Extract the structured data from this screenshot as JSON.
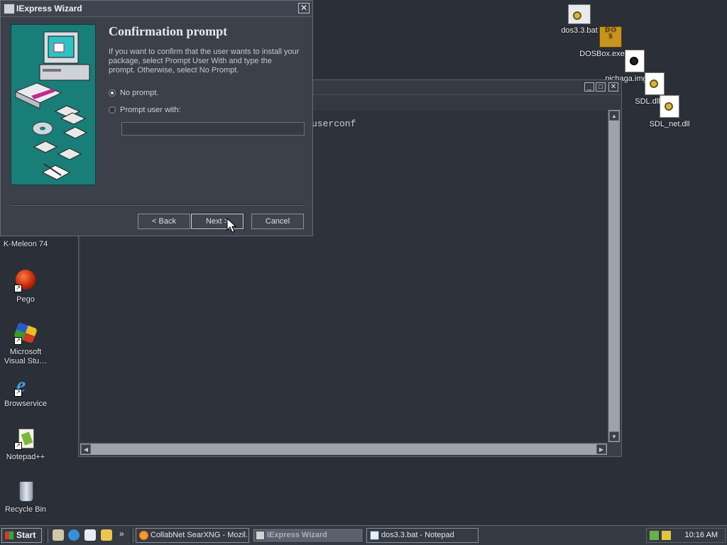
{
  "desktop": {
    "left_icons": [
      {
        "label": "K-Meleon 74",
        "icon": "kmeleon-icon"
      },
      {
        "label": "Pego",
        "icon": "pego-icon"
      },
      {
        "label": "Microsoft Visual Stu…",
        "icon": "visual-studio-icon"
      },
      {
        "label": "Browservice",
        "icon": "internet-explorer-icon"
      },
      {
        "label": "Notepad++",
        "icon": "notepadpp-icon"
      },
      {
        "label": "Recycle Bin",
        "icon": "recycle-bin-icon"
      }
    ],
    "right_icons": [
      {
        "label": "dos3.3.bat",
        "icon": "batch-file-icon"
      },
      {
        "label": "DOSBox.exe",
        "icon": "dosbox-icon"
      },
      {
        "label": "pichaga.img",
        "icon": "disk-image-icon"
      },
      {
        "label": "SDL.dll",
        "icon": "dll-icon"
      },
      {
        "label": "SDL_net.dll",
        "icon": "dll-icon"
      }
    ]
  },
  "notepad": {
    "visible_text": "userconf",
    "controls": {
      "minimize": "_",
      "maximize": "□",
      "close": "✕"
    }
  },
  "wizard": {
    "title": "IExpress Wizard",
    "heading": "Confirmation prompt",
    "description": "If you want to confirm that the user wants to install your package, select Prompt User With and type the prompt. Otherwise, select No Prompt.",
    "options": [
      {
        "label": "No prompt.",
        "selected": true
      },
      {
        "label": "Prompt user with:",
        "selected": false
      }
    ],
    "prompt_value": "",
    "buttons": {
      "back": "< Back",
      "next": "Next >",
      "cancel": "Cancel"
    },
    "close_glyph": "✕"
  },
  "taskbar": {
    "start_label": "Start",
    "quick_launch": [
      "show-desktop-icon",
      "ie-icon",
      "outlook-icon",
      "explorer-icon"
    ],
    "overflow": "»",
    "tasks": [
      {
        "label": "CollabNet SearXNG - Mozil...",
        "icon": "firefox-icon",
        "active": false
      },
      {
        "label": "IExpress Wizard",
        "icon": "iexpress-icon",
        "active": true
      },
      {
        "label": "dos3.3.bat - Notepad",
        "icon": "notepad-icon",
        "active": false
      }
    ],
    "clock": "10:16 AM"
  },
  "colors": {
    "desktop_bg": "#2b2f38",
    "art_teal": "#197d78",
    "window_bg": "#3b404b"
  }
}
